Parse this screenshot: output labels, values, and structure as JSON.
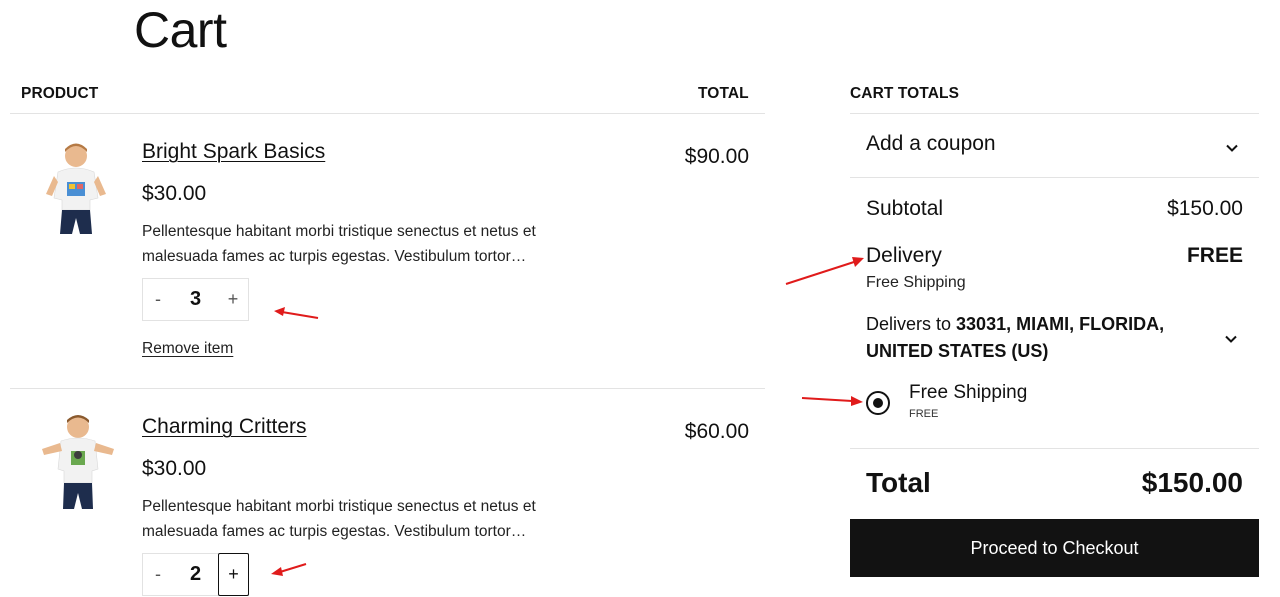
{
  "page": {
    "title": "Cart"
  },
  "table": {
    "product_header": "PRODUCT",
    "total_header": "TOTAL"
  },
  "items": [
    {
      "name": "Bright Spark Basics",
      "price": "$30.00",
      "description": "Pellentesque habitant morbi tristique senectus et netus et malesuada fames ac turpis egestas. Vestibulum tortor…",
      "quantity": "3",
      "minus_label": "-",
      "plus_label": "+",
      "line_total": "$90.00",
      "remove_label": "Remove item",
      "image_icon": "boy-tshirt-photo"
    },
    {
      "name": "Charming Critters",
      "price": "$30.00",
      "description": "Pellentesque habitant morbi tristique senectus et netus et malesuada fames ac turpis egestas. Vestibulum tortor…",
      "quantity": "2",
      "minus_label": "-",
      "plus_label": "+",
      "line_total": "$60.00",
      "image_icon": "boy-tshirt-photo"
    }
  ],
  "totals": {
    "header": "CART TOTALS",
    "coupon_label": "Add a coupon",
    "subtotal_label": "Subtotal",
    "subtotal_value": "$150.00",
    "delivery_label": "Delivery",
    "delivery_value": "FREE",
    "delivery_method": "Free Shipping",
    "delivers_to_prefix": "Delivers to ",
    "delivers_to_address": "33031, MIAMI, FLORIDA, UNITED STATES (US)",
    "shipping_option_label": "Free Shipping",
    "shipping_option_price": "FREE",
    "total_label": "Total",
    "total_value": "$150.00",
    "checkout_label": "Proceed to Checkout"
  },
  "colors": {
    "text": "#111111",
    "divider": "#e3e3e3",
    "checkout_bg": "#121212",
    "annotation_arrow": "#e01b1b"
  }
}
